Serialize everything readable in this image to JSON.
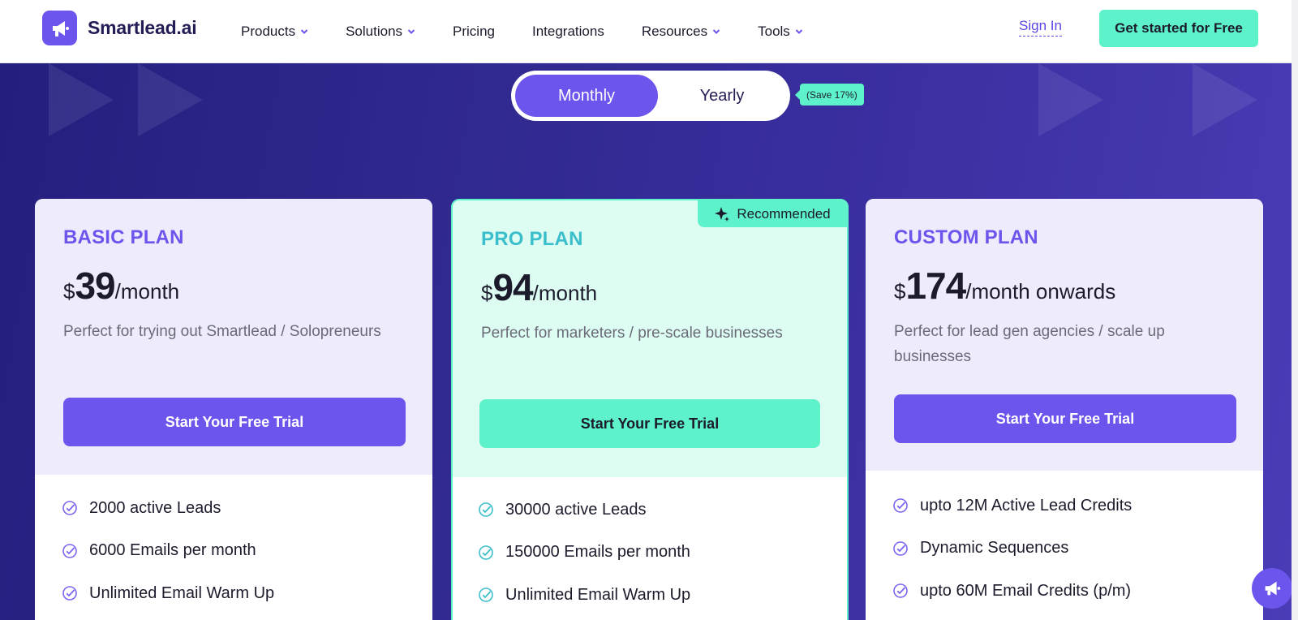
{
  "brand": {
    "name": "Smartlead.ai",
    "accent": "#6c55ec",
    "mint": "#5ef2cb"
  },
  "nav": {
    "items": [
      {
        "label": "Products",
        "dropdown": true
      },
      {
        "label": "Solutions",
        "dropdown": true
      },
      {
        "label": "Pricing",
        "dropdown": false
      },
      {
        "label": "Integrations",
        "dropdown": false
      },
      {
        "label": "Resources",
        "dropdown": true
      },
      {
        "label": "Tools",
        "dropdown": true
      }
    ],
    "signin": "Sign In",
    "cta": "Get started for Free"
  },
  "billing": {
    "monthly": "Monthly",
    "yearly": "Yearly",
    "selected": "Monthly",
    "save_badge": "(Save 17%)"
  },
  "plans": [
    {
      "name": "BASIC PLAN",
      "currency": "$",
      "amount": "39",
      "period": "/month",
      "description": "Perfect for trying out Smartlead / Solopreneurs",
      "button": "Start Your Free Trial",
      "features": [
        "2000 active Leads",
        "6000 Emails per month",
        "Unlimited Email Warm Up"
      ]
    },
    {
      "name": "PRO PLAN",
      "badge": "Recommended",
      "currency": "$",
      "amount": "94",
      "period": "/month",
      "description": "Perfect for marketers / pre-scale businesses",
      "button": "Start Your Free Trial",
      "features": [
        "30000 active Leads",
        "150000 Emails per month",
        "Unlimited Email Warm Up"
      ]
    },
    {
      "name": "CUSTOM PLAN",
      "currency": "$",
      "amount": "174",
      "period": "/month onwards",
      "description": "Perfect for lead gen agencies / scale up businesses",
      "button": "Start Your Free Trial",
      "features": [
        "upto 12M Active Lead Credits",
        "Dynamic Sequences",
        "upto 60M Email Credits (p/m)"
      ]
    }
  ],
  "icons": {
    "logo": "megaphone-icon",
    "chevron": "chevron-down-icon",
    "check": "check-circle-icon",
    "sparkle": "sparkle-icon",
    "chat": "megaphone-chat-icon"
  }
}
